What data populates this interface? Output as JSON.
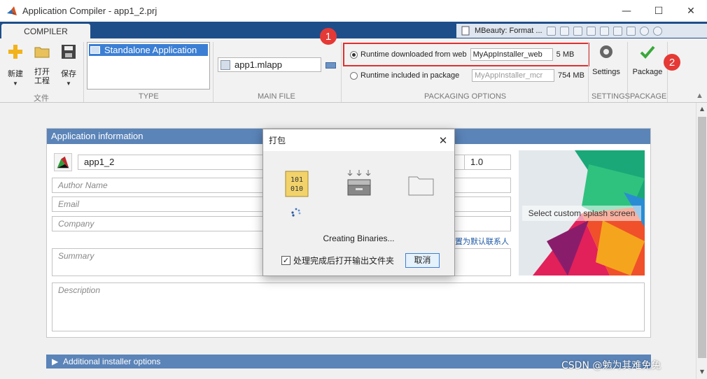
{
  "window": {
    "title": "Application Compiler - app1_2.prj",
    "minimize": "—",
    "maximize": "☐",
    "close": "✕"
  },
  "tabs": {
    "compiler": "COMPILER"
  },
  "toolstrip": {
    "doc_title": "MBeauty: Format ..."
  },
  "ribbon": {
    "new_label": "新建",
    "open_label": "打开\n工程",
    "save_label": "保存",
    "type_item": "Standalone Application",
    "main_file": "app1.mlapp",
    "web_label": "Runtime downloaded from web",
    "web_value": "MyAppInstaller_web",
    "web_size": "5 MB",
    "pkg_label": "Runtime included in package",
    "pkg_value": "MyAppInstaller_mcr",
    "pkg_size": "754 MB",
    "settings_label": "Settings",
    "package_label": "Package",
    "sections": {
      "file": "文件",
      "type": "TYPE",
      "main_file": "MAIN FILE",
      "packaging": "PACKAGING OPTIONS",
      "settings": "SETTINGS",
      "package": "PACKAGE"
    },
    "badge_1": "1",
    "badge_2": "2"
  },
  "app_info": {
    "header": "Application information",
    "name": "app1_2",
    "version": "1.0",
    "author_placeholder": "Author Name",
    "email_placeholder": "Email",
    "company_placeholder": "Company",
    "default_contact_link": "置为默认联系人",
    "summary_placeholder": "Summary",
    "description_placeholder": "Description",
    "splash_text": "Select custom splash screen",
    "additional_header": "Additional installer options"
  },
  "dialog": {
    "title": "打包",
    "status": "Creating Binaries...",
    "checkbox_label": "处理完成后打开输出文件夹",
    "checkbox_checked": true,
    "cancel_label": "取消",
    "icon_binary_text": "101\n010"
  },
  "watermark": "CSDN @勉为其难免免",
  "colors": {
    "accent": "#5b84b8",
    "tabstrip": "#1d4e8a",
    "highlight": "#e03030"
  }
}
